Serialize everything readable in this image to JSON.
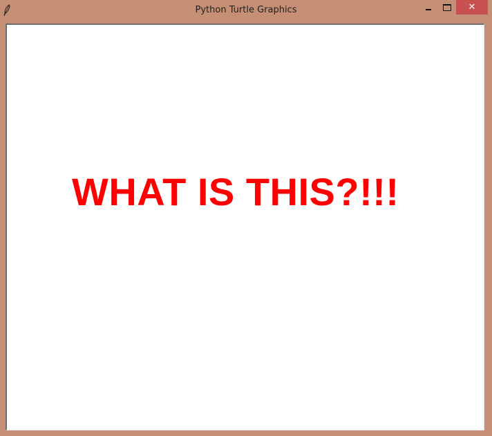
{
  "window": {
    "title": "Python Turtle Graphics",
    "frame_color": "#c48f74",
    "close_color": "#c75050",
    "controls": {
      "minimize_glyph": "",
      "maximize_glyph": "",
      "close_glyph": "✕"
    }
  },
  "canvas": {
    "background": "#ffffff",
    "text": "WHAT IS THIS?!!!",
    "text_color": "#ff0000"
  },
  "icons": {
    "app": "feather-icon",
    "minimize": "minimize-icon",
    "maximize": "maximize-icon",
    "close": "close-icon"
  }
}
